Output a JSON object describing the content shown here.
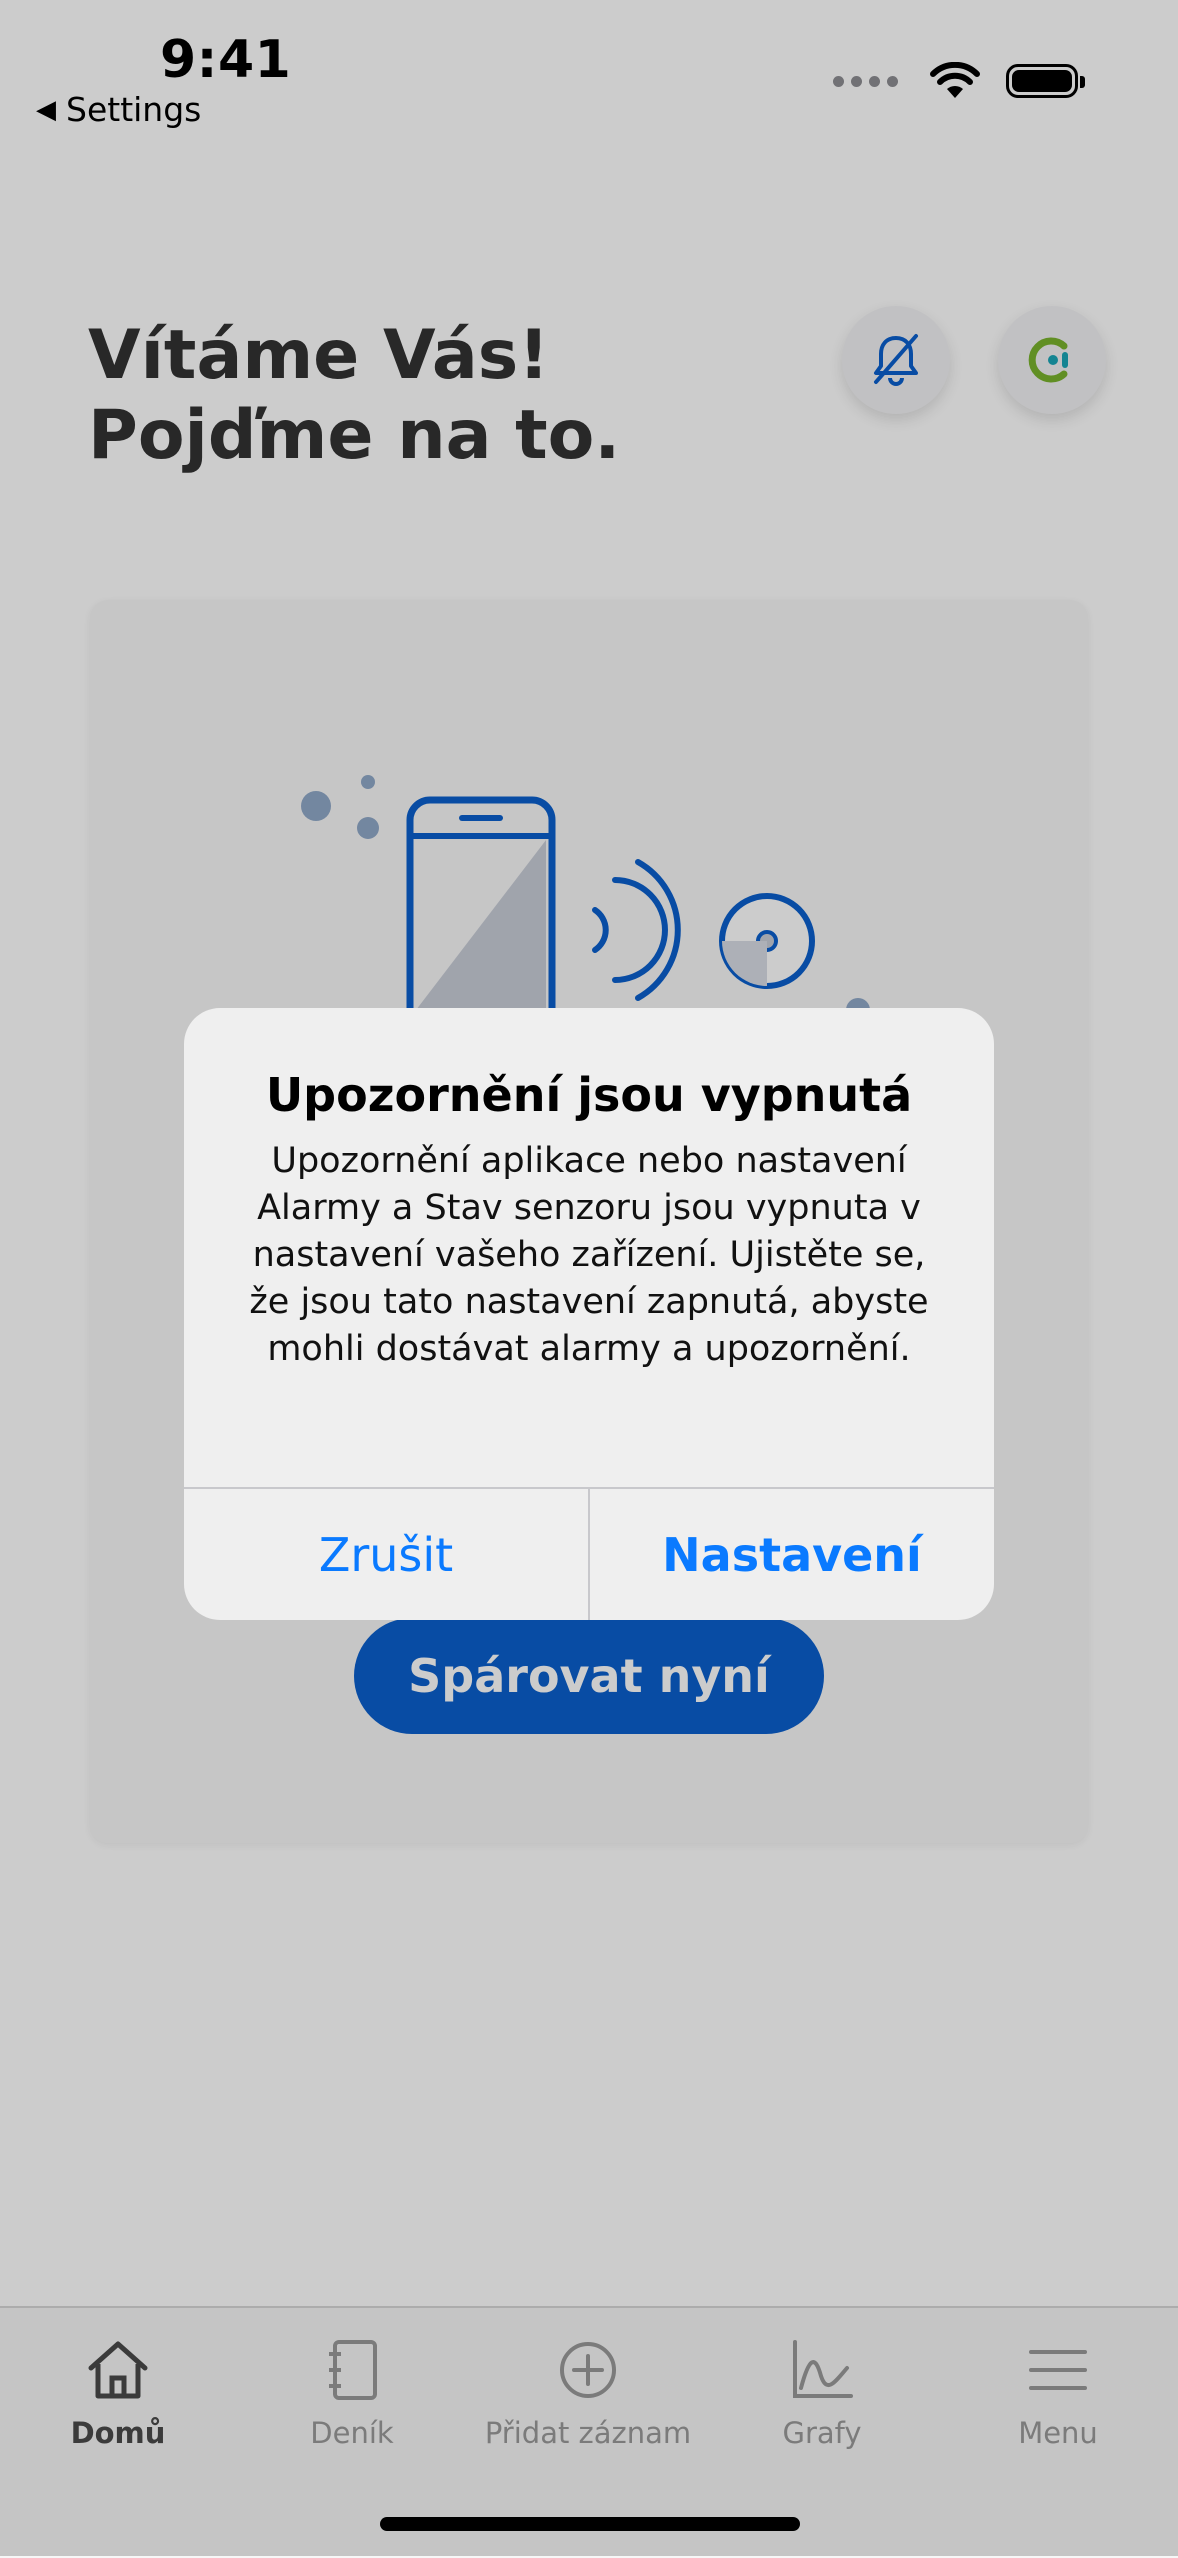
{
  "status_bar": {
    "time": "9:41",
    "back_label": "Settings"
  },
  "welcome": {
    "line1": "Vítáme Vás!",
    "line2": "Pojďme na to."
  },
  "card": {
    "pair_button": "Spárovat nyní"
  },
  "alert": {
    "title": "Upozornění jsou vypnutá",
    "message": "Upozornění aplikace nebo nastavení Alarmy a Stav senzoru jsou vypnuta v nastavení vašeho zařízení. Ujistěte se, že jsou tato nastavení zapnutá, abyste mohli dostávat alarmy a upozornění.",
    "cancel": "Zrušit",
    "settings": "Nastavení"
  },
  "tabs": [
    {
      "label": "Domů",
      "icon": "home-icon",
      "active": true
    },
    {
      "label": "Deník",
      "icon": "diary-icon"
    },
    {
      "label": "Přidat záznam",
      "icon": "add-circle-icon"
    },
    {
      "label": "Grafy",
      "icon": "chart-icon"
    },
    {
      "label": "Menu",
      "icon": "menu-icon"
    }
  ],
  "colors": {
    "accent": "#0a7aff",
    "brand_blue": "#0a5fcd",
    "logo_green": "#7ab32e",
    "logo_teal": "#1aa6b7"
  }
}
